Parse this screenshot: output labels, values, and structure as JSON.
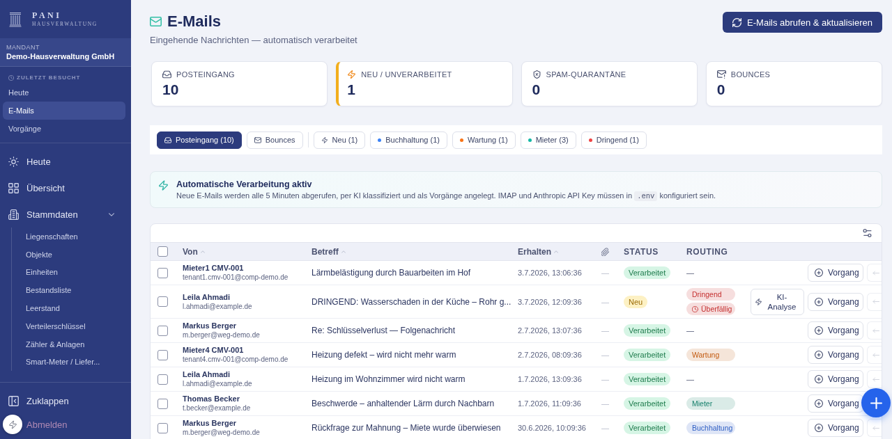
{
  "sidebar": {
    "logo": {
      "title": "PANI",
      "subtitle": "HAUSVERWALTUNG"
    },
    "tenant": {
      "label": "MANDANT",
      "name": "Demo-Hausverwaltung GmbH"
    },
    "recent": {
      "heading": "ZULETZT BESUCHT",
      "items": [
        {
          "label": "Heute",
          "selected": false
        },
        {
          "label": "E-Mails",
          "selected": true
        },
        {
          "label": "Vorgänge",
          "selected": false
        }
      ]
    },
    "nav": [
      {
        "label": "Heute",
        "kind": "today"
      },
      {
        "label": "Übersicht",
        "kind": "overview"
      },
      {
        "label": "Stammdaten",
        "kind": "masterdata",
        "expanded": true,
        "children": [
          {
            "label": "Liegenschaften"
          },
          {
            "label": "Objekte"
          },
          {
            "label": "Einheiten"
          },
          {
            "label": "Bestandsliste"
          },
          {
            "label": "Leerstand"
          },
          {
            "label": "Verteilerschlüssel"
          },
          {
            "label": "Zähler & Anlagen"
          },
          {
            "label": "Smart-Meter / Liefer..."
          }
        ]
      }
    ],
    "footer": [
      {
        "label": "Zuklappen",
        "kind": "collapse"
      },
      {
        "label": "Abmelden",
        "kind": "logout"
      }
    ]
  },
  "header": {
    "title": "E-Mails",
    "subtitle": "Eingehende Nachrichten — automatisch verarbeitet",
    "action": "E-Mails abrufen & aktualisieren"
  },
  "stats": [
    {
      "label": "POSTEINGANG",
      "value": "10",
      "kind": "inbox",
      "highlighted": false
    },
    {
      "label": "NEU / UNVERARBEITET",
      "value": "1",
      "kind": "new",
      "highlighted": true
    },
    {
      "label": "SPAM-QUARANTÄNE",
      "value": "0",
      "kind": "spam",
      "highlighted": false
    },
    {
      "label": "BOUNCES",
      "value": "0",
      "kind": "bounce",
      "highlighted": false
    }
  ],
  "filters": {
    "mailboxes": [
      {
        "label": "Posteingang (10)",
        "kind": "inbox",
        "selected": true
      },
      {
        "label": "Bounces",
        "kind": "bounce",
        "selected": false
      }
    ],
    "categories": [
      {
        "label": "Neu (1)",
        "kind": "new",
        "selected": false
      },
      {
        "label": "Buchhaltung (1)",
        "kind": "tag",
        "color": "#3b82f6",
        "selected": false
      },
      {
        "label": "Wartung (1)",
        "kind": "tag",
        "color": "#f97316",
        "selected": false
      },
      {
        "label": "Mieter (3)",
        "kind": "tag",
        "color": "#14b8a6",
        "selected": false
      },
      {
        "label": "Dringend (1)",
        "kind": "tag",
        "color": "#ef4444",
        "selected": false
      }
    ]
  },
  "banner": {
    "title": "Automatische Verarbeitung aktiv",
    "text": [
      {
        "kind": "text",
        "text": "Neue E-Mails werden alle 5 Minuten abgerufen, per KI klassifiziert und als Vorgänge angelegt. IMAP und Anthropic API Key müssen in "
      },
      {
        "kind": "code",
        "text": ".env"
      },
      {
        "kind": "text",
        "text": " konfiguriert sein."
      }
    ]
  },
  "table": {
    "select_all_checked": false,
    "columns": [
      {
        "kind": "text",
        "label": "Von",
        "sortable": true
      },
      {
        "kind": "text",
        "label": "Betreff",
        "sortable": true
      },
      {
        "kind": "text",
        "label": "Erhalten",
        "sortable": true
      },
      {
        "kind": "attachment"
      },
      {
        "kind": "text",
        "label": "STATUS",
        "sortable": false
      },
      {
        "kind": "text",
        "label": "ROUTING",
        "sortable": false
      }
    ],
    "rows": [
      {
        "checked": false,
        "sender_name": "Mieter1 CMV-001",
        "sender_email": "tenant1.cmv-001@comp-demo.de",
        "subject": "Lärmbelästigung durch Bauarbeiten im Hof",
        "received": "3.7.2026, 13:06:36",
        "attachment": "—",
        "status": {
          "label": "Verarbeitet",
          "kind": "processed"
        },
        "routing": [
          {
            "kind": "none",
            "label": "—"
          }
        ],
        "actions": [
          {
            "kind": "case",
            "label": "Vorgang"
          },
          {
            "kind": "link"
          }
        ]
      },
      {
        "checked": false,
        "sender_name": "Leila Ahmadi",
        "sender_email": "l.ahmadi@example.de",
        "subject": "DRINGEND: Wasserschaden in der Küche – Rohr g...",
        "received": "3.7.2026, 12:09:36",
        "attachment": "—",
        "status": {
          "label": "Neu",
          "kind": "new"
        },
        "routing": [
          {
            "kind": "tag",
            "label": "Dringend",
            "color": "#c53030"
          },
          {
            "kind": "overdue",
            "label": "Überfällig",
            "color": "#c53030"
          }
        ],
        "actions": [
          {
            "kind": "ai",
            "label": "KI-Analyse"
          },
          {
            "kind": "case",
            "label": "Vorgang"
          },
          {
            "kind": "link"
          }
        ]
      },
      {
        "checked": false,
        "sender_name": "Markus Berger",
        "sender_email": "m.berger@weg-demo.de",
        "subject": "Re: Schlüsselverlust — Folgenachricht",
        "received": "2.7.2026, 13:07:36",
        "attachment": "—",
        "status": {
          "label": "Verarbeitet",
          "kind": "processed"
        },
        "routing": [
          {
            "kind": "none",
            "label": "—"
          }
        ],
        "actions": [
          {
            "kind": "case",
            "label": "Vorgang"
          },
          {
            "kind": "link"
          }
        ]
      },
      {
        "checked": false,
        "sender_name": "Mieter4 CMV-001",
        "sender_email": "tenant4.cmv-001@comp-demo.de",
        "subject": "Heizung defekt – wird nicht mehr warm",
        "received": "2.7.2026, 08:09:36",
        "attachment": "—",
        "status": {
          "label": "Verarbeitet",
          "kind": "processed"
        },
        "routing": [
          {
            "kind": "tag",
            "label": "Wartung",
            "color": "#c25a10"
          }
        ],
        "actions": [
          {
            "kind": "case",
            "label": "Vorgang"
          },
          {
            "kind": "link"
          }
        ]
      },
      {
        "checked": false,
        "sender_name": "Leila Ahmadi",
        "sender_email": "l.ahmadi@example.de",
        "subject": "Heizung im Wohnzimmer wird nicht warm",
        "received": "1.7.2026, 13:09:36",
        "attachment": "—",
        "status": {
          "label": "Verarbeitet",
          "kind": "processed"
        },
        "routing": [
          {
            "kind": "none",
            "label": "—"
          }
        ],
        "actions": [
          {
            "kind": "case",
            "label": "Vorgang"
          },
          {
            "kind": "link"
          }
        ]
      },
      {
        "checked": false,
        "sender_name": "Thomas Becker",
        "sender_email": "t.becker@example.de",
        "subject": "Beschwerde – anhaltender Lärm durch Nachbarn",
        "received": "1.7.2026, 11:09:36",
        "attachment": "—",
        "status": {
          "label": "Verarbeitet",
          "kind": "processed"
        },
        "routing": [
          {
            "kind": "tag",
            "label": "Mieter",
            "color": "#16806c"
          }
        ],
        "actions": [
          {
            "kind": "case",
            "label": "Vorgang"
          }
        ]
      },
      {
        "checked": false,
        "sender_name": "Markus Berger",
        "sender_email": "m.berger@weg-demo.de",
        "subject": "Rückfrage zur Mahnung – Miete wurde überwiesen",
        "received": "30.6.2026, 10:09:36",
        "attachment": "—",
        "status": {
          "label": "Verarbeitet",
          "kind": "processed"
        },
        "routing": [
          {
            "kind": "tag",
            "label": "Buchhaltung",
            "color": "#2f5fc4"
          }
        ],
        "actions": [
          {
            "kind": "case",
            "label": "Vorgang"
          },
          {
            "kind": "link"
          }
        ]
      }
    ]
  }
}
